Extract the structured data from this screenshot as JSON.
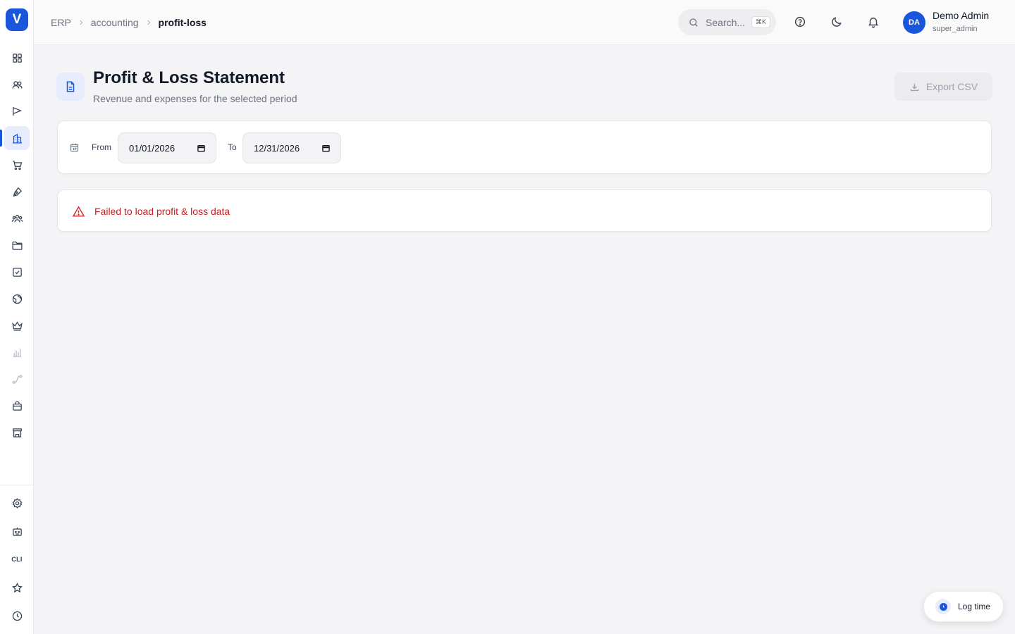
{
  "app": {
    "logo_letter": "V"
  },
  "breadcrumb": {
    "items": [
      "ERP",
      "accounting"
    ],
    "current": "profit-loss"
  },
  "header": {
    "search_placeholder": "Search...",
    "search_shortcut": "⌘K",
    "user": {
      "initials": "DA",
      "name": "Demo Admin",
      "role": "super_admin"
    }
  },
  "sidebar": {
    "icons": [
      "dashboard-icon",
      "users-icon",
      "campaigns-icon",
      "accounting-icon",
      "cart-icon",
      "pen-icon",
      "team-icon",
      "folder-icon",
      "tasks-icon",
      "globe-icon",
      "crown-icon",
      "bar-chart-icon",
      "workflow-icon",
      "shopping-bag-icon",
      "store-icon"
    ],
    "bottom_icons": [
      "settings-icon",
      "bot-icon",
      "cli-icon",
      "star-icon",
      "clock-icon"
    ],
    "cli_label": "CLI",
    "active": "accounting-icon"
  },
  "page": {
    "title": "Profit & Loss Statement",
    "subtitle": "Revenue and expenses for the selected period",
    "export_label": "Export CSV"
  },
  "filters": {
    "from_label": "From",
    "from_value": "01/01/2026",
    "to_label": "To",
    "to_value": "12/31/2026"
  },
  "error": {
    "message": "Failed to load profit & loss data"
  },
  "log_time": {
    "label": "Log time"
  },
  "colors": {
    "accent": "#1a56db",
    "error": "#c81e1e"
  }
}
